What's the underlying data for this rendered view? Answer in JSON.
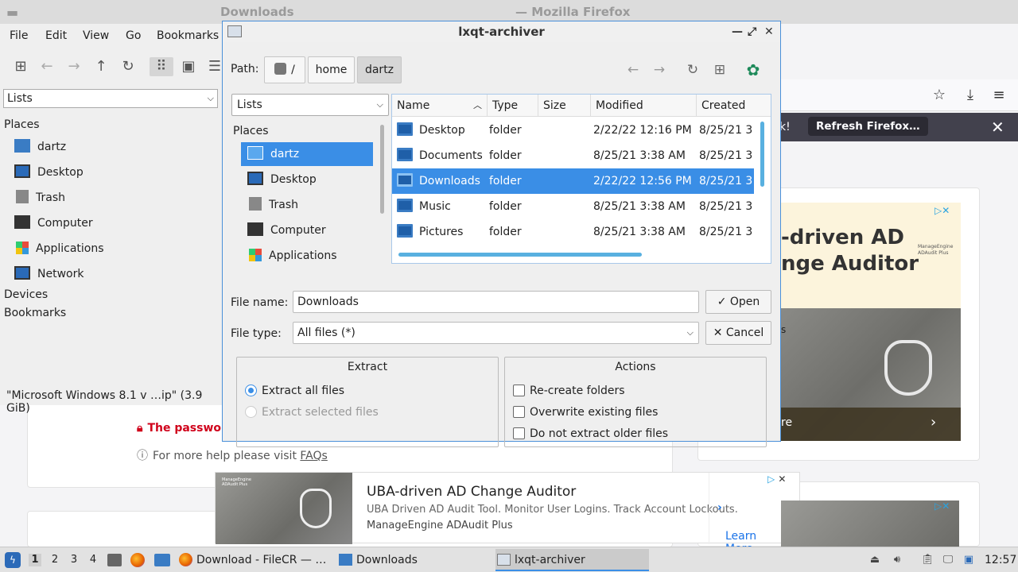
{
  "firefox": {
    "title_left": "Downloads",
    "title_right": "— Mozilla Firefox",
    "notification_bang": "k!",
    "refresh_button": "Refresh Firefox…",
    "password_note": "The passwor",
    "help_note": "For more help please visit",
    "help_link": "FAQs"
  },
  "ad_right": {
    "headline_line1": "-driven AD",
    "headline_line2": "nge Auditor",
    "brand": "ManageEngine ADAudit Plus",
    "cta": "re",
    "side_text": "s"
  },
  "ad_bottom": {
    "brand": "ManageEngine ADAudit Plus",
    "headline": "UBA-driven AD Change Auditor",
    "description": "UBA Driven AD Audit Tool. Monitor User Logins. Track Account Lockouts.",
    "sponsor": "ManageEngine ADAudit Plus",
    "cta": "Learn More"
  },
  "filemanager": {
    "menu": [
      "File",
      "Edit",
      "View",
      "Go",
      "Bookmarks"
    ],
    "view_combo": "Lists",
    "places_header": "Places",
    "places": [
      "dartz",
      "Desktop",
      "Trash",
      "Computer",
      "Applications",
      "Network"
    ],
    "devices": "Devices",
    "bookmarks": "Bookmarks",
    "status": "\"Microsoft Windows 8.1 v …ip\" (3.9 GiB)"
  },
  "dialog": {
    "title": "lxqt-archiver",
    "path_label": "Path:",
    "crumbs": [
      "/",
      "home",
      "dartz"
    ],
    "view_combo": "Lists",
    "places_header": "Places",
    "places": [
      "dartz",
      "Desktop",
      "Trash",
      "Computer",
      "Applications"
    ],
    "columns": [
      "Name",
      "Type",
      "Size",
      "Modified",
      "Created"
    ],
    "files": [
      {
        "name": "Desktop",
        "type": "folder",
        "modified": "2/22/22 12:16 PM",
        "created": "8/25/21 3:"
      },
      {
        "name": "Documents",
        "type": "folder",
        "modified": "8/25/21 3:38 AM",
        "created": "8/25/21 3:"
      },
      {
        "name": "Downloads",
        "type": "folder",
        "modified": "2/22/22 12:56 PM",
        "created": "8/25/21 3:"
      },
      {
        "name": "Music",
        "type": "folder",
        "modified": "8/25/21 3:38 AM",
        "created": "8/25/21 3:"
      },
      {
        "name": "Pictures",
        "type": "folder",
        "modified": "8/25/21 3:38 AM",
        "created": "8/25/21 3:"
      }
    ],
    "file_name_label": "File name:",
    "file_name_value": "Downloads",
    "file_type_label": "File type:",
    "file_type_value": "All files (*)",
    "open_button": "Open",
    "cancel_button": "Cancel",
    "extract": {
      "title": "Extract",
      "all": "Extract all files",
      "selected": "Extract selected files"
    },
    "actions": {
      "title": "Actions",
      "recreate": "Re-create folders",
      "overwrite": "Overwrite existing files",
      "no_older": "Do not extract older files"
    }
  },
  "taskbar": {
    "desktops": [
      "1",
      "2",
      "3",
      "4"
    ],
    "tasks": [
      "Download - FileCR — …",
      "Downloads",
      "lxqt-archiver"
    ],
    "clock": "12:57"
  },
  "colors": {
    "selection": "#3a8ee6",
    "accent_border": "#4a90d9",
    "notification_bar": "#42414d",
    "alert_red": "#d0021b"
  }
}
